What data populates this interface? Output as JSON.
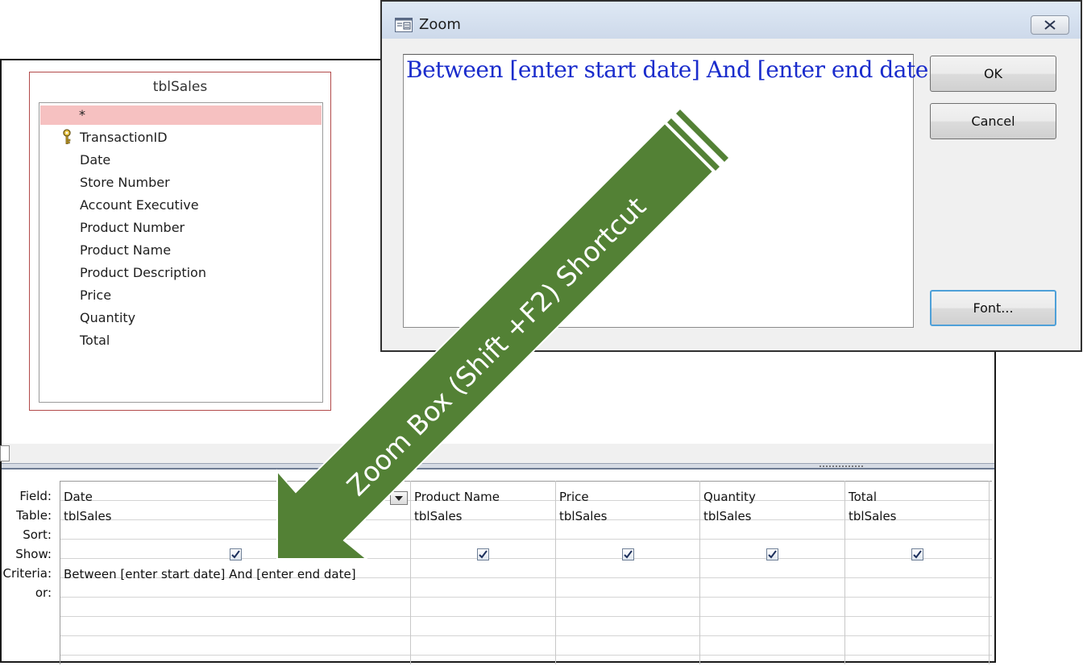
{
  "table_box": {
    "title": "tblSales",
    "star": "*",
    "fields": [
      "TransactionID",
      "Date",
      "Store Number",
      "Account Executive",
      "Product Number",
      "Product Name",
      "Product Description",
      "Price",
      "Quantity",
      "Total"
    ]
  },
  "grid": {
    "row_labels": [
      "Field:",
      "Table:",
      "Sort:",
      "Show:",
      "Criteria:",
      "or:"
    ],
    "columns": [
      {
        "field": "Date",
        "table": "tblSales",
        "show": true,
        "criteria": "Between [enter start date] And [enter end date]"
      },
      {
        "field": "Product Name",
        "table": "tblSales",
        "show": true,
        "criteria": ""
      },
      {
        "field": "Price",
        "table": "tblSales",
        "show": true,
        "criteria": ""
      },
      {
        "field": "Quantity",
        "table": "tblSales",
        "show": true,
        "criteria": ""
      },
      {
        "field": "Total",
        "table": "tblSales",
        "show": true,
        "criteria": ""
      }
    ]
  },
  "zoom_dialog": {
    "title": "Zoom",
    "text": "Between [enter start date] And [enter end date]",
    "ok_label": "OK",
    "cancel_label": "Cancel",
    "font_label": "Font..."
  },
  "callout": {
    "label": "Zoom Box (Shift +F2) Shortcut",
    "fill_color": "#538135"
  },
  "icons": {
    "key": "key-icon",
    "zoom_window": "window-icon",
    "close": "close-icon",
    "checkmark": "checkmark-icon",
    "dropdown": "chevron-down-icon"
  }
}
